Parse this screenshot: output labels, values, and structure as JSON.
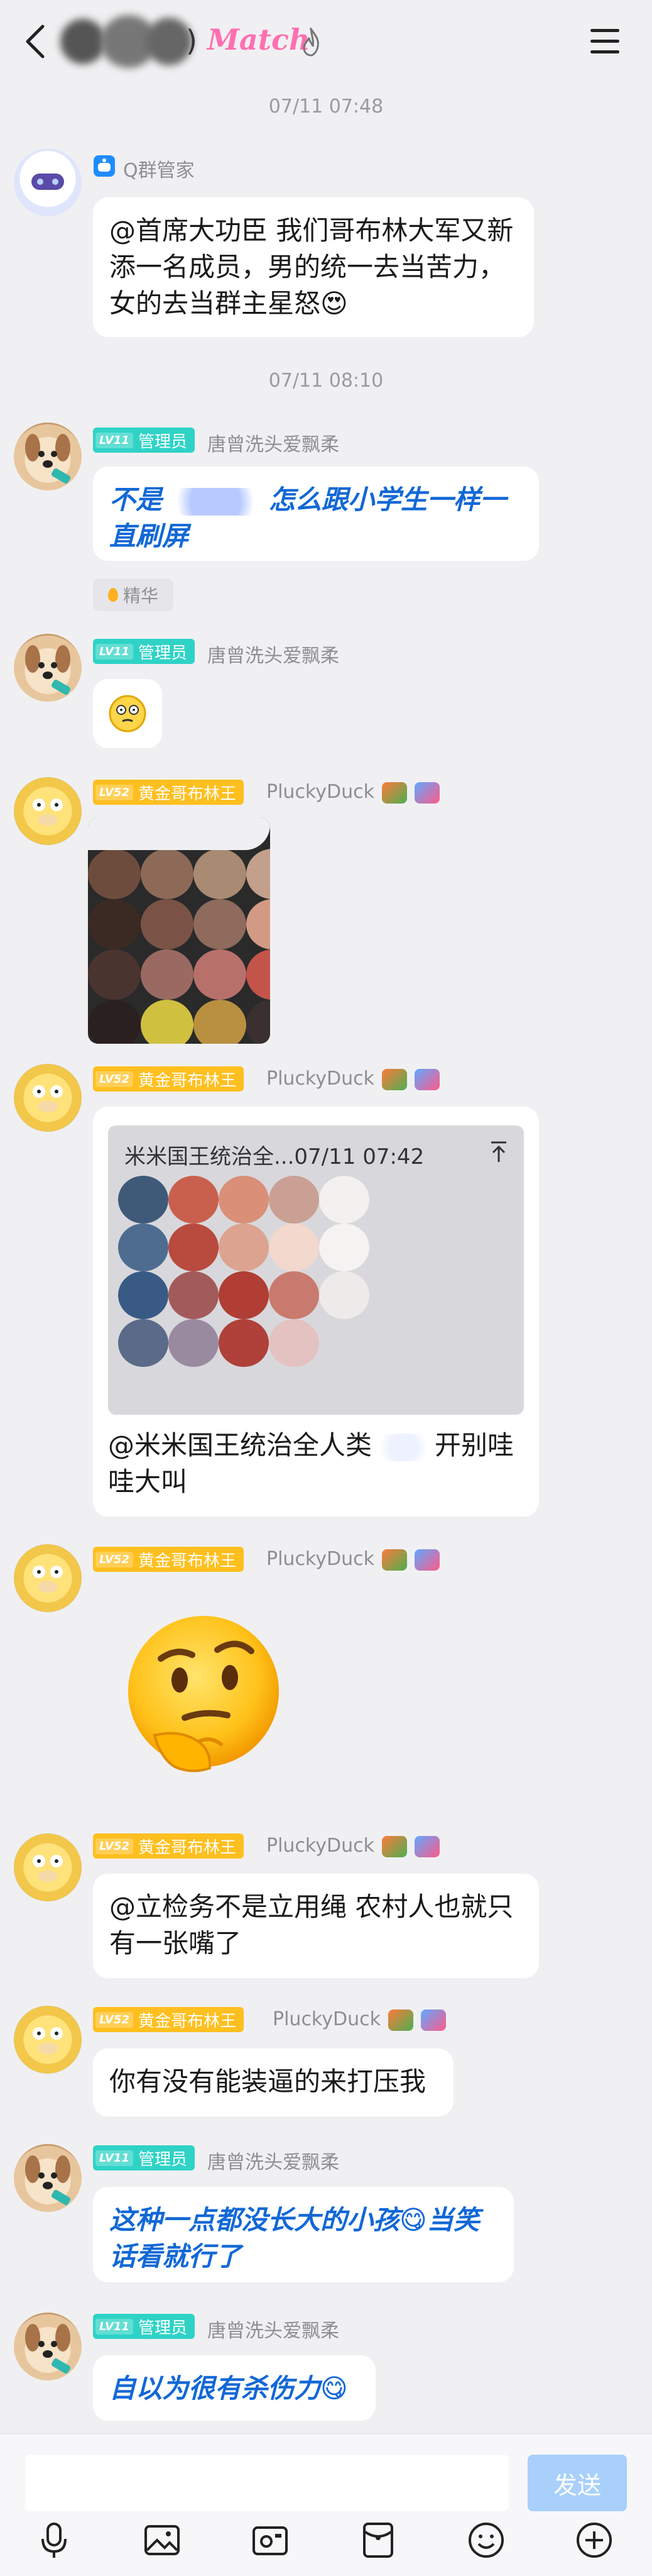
{
  "header": {
    "title_suffix": ")",
    "title_match": "Match",
    "menu_icon": "hamburger-menu-icon"
  },
  "timestamps": [
    "07/11 07:48",
    "07/11 08:10"
  ],
  "messages": [
    {
      "avatar": "robot-avatar",
      "sender": "Q群管家",
      "text": "@首席大功臣 我们哥布林大军又新添一名成员，男的统一去当苦力，女的去当群主星怒😍"
    },
    {
      "avatar": "dog-avatar",
      "level": "LV11",
      "role": "管理员",
      "sender": "唐曾洗头爱飘柔",
      "text_a": "不是",
      "text_b": "怎么跟小学生一样一直刷屏",
      "tag": "精华"
    },
    {
      "avatar": "dog-avatar",
      "level": "LV11",
      "role": "管理员",
      "sender": "唐曾洗头爱飘柔",
      "sticker": "thinking-face-sticker"
    },
    {
      "avatar": "duck-avatar",
      "level": "LV52",
      "role": "黄金哥布林王",
      "sender": "PluckyDuck",
      "image": "blurred-photo"
    },
    {
      "avatar": "duck-avatar",
      "level": "LV52",
      "role": "黄金哥布林王",
      "sender": "PluckyDuck",
      "quote_title": "米米国王统治全...07/11 07:42",
      "text_a": "@米米国王统治全人类",
      "text_b": "开别哇哇大叫"
    },
    {
      "avatar": "duck-avatar",
      "level": "LV52",
      "role": "黄金哥布林王",
      "sender": "PluckyDuck",
      "sticker": "thinking-face-emoji"
    },
    {
      "avatar": "duck-avatar",
      "level": "LV52",
      "role": "黄金哥布林王",
      "sender": "PluckyDuck",
      "text": "@立检务不是立用绳 农村人也就只有一张嘴了"
    },
    {
      "avatar": "duck-avatar",
      "level": "LV52",
      "role": "黄金哥布林王",
      "sender": "PluckyDuck",
      "text": "你有没有能装逼的来打压我"
    },
    {
      "avatar": "dog-avatar",
      "level": "LV11",
      "role": "管理员",
      "sender": "唐曾洗头爱飘柔",
      "text": "这种一点都没长大的小孩😋当笑话看就行了"
    },
    {
      "avatar": "dog-avatar",
      "level": "LV11",
      "role": "管理员",
      "sender": "唐曾洗头爱飘柔",
      "text": "自以为很有杀伤力😋"
    }
  ],
  "input": {
    "placeholder": "",
    "send_label": "发送"
  },
  "toolbar": [
    "microphone-icon",
    "image-icon",
    "camera-icon",
    "red-packet-icon",
    "emoji-icon",
    "plus-icon"
  ],
  "colors": {
    "admin_badge": "#2fd3c6",
    "gold_badge": "#ffbf1f",
    "blue_text": "#1268d6",
    "send_button": "#a8d0fb",
    "background": "#f0f0f2"
  }
}
